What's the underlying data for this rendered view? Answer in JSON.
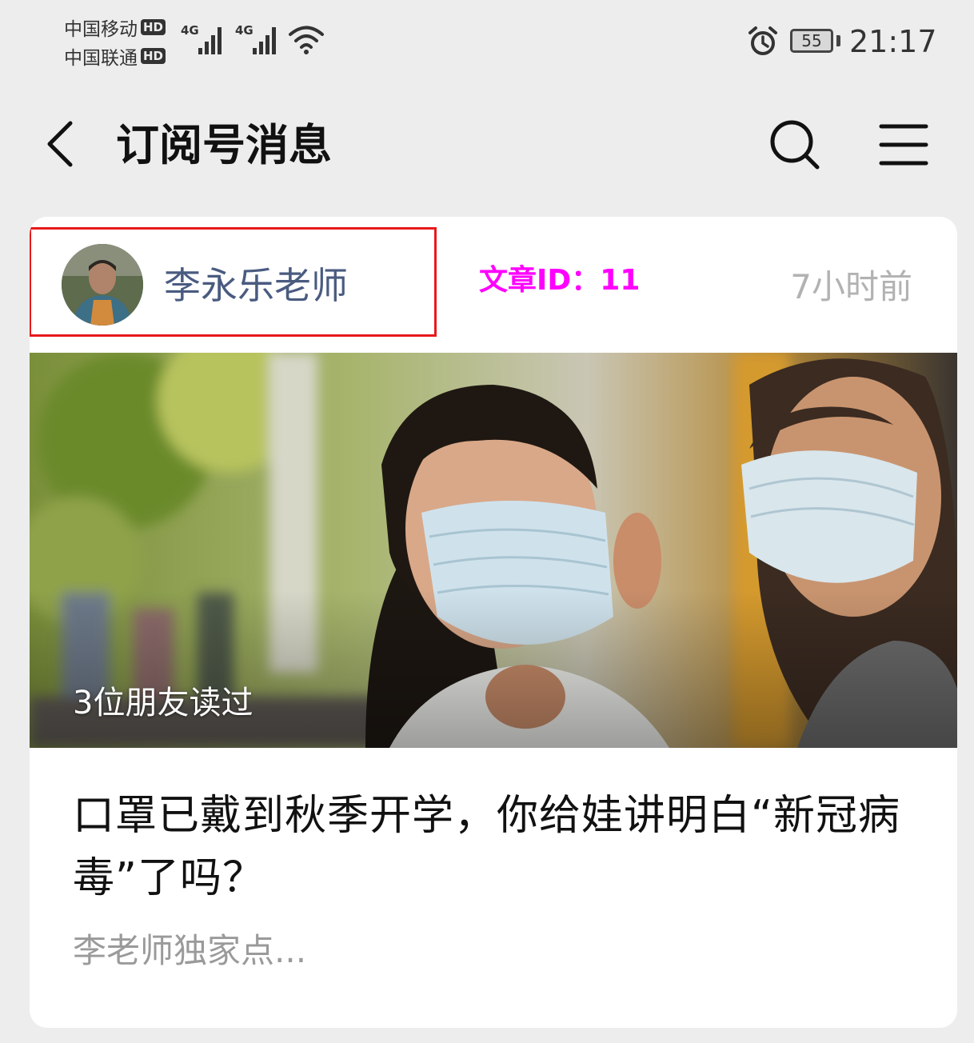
{
  "status_bar": {
    "carriers": [
      {
        "name": "中国移动",
        "badge": "HD"
      },
      {
        "name": "中国联通",
        "badge": "HD"
      }
    ],
    "network_label": "4G",
    "battery_level": "55",
    "time": "21:17"
  },
  "header": {
    "title": "订阅号消息"
  },
  "card": {
    "author_name": "李永乐老师",
    "article_id_label": "文章ID：11",
    "time_ago": "7小时前",
    "read_by": "3位朋友读过",
    "title": "口罩已戴到秋季开学，你给娃讲明白“新冠病毒”了吗？",
    "digest": "李老师独家点..."
  },
  "colors": {
    "background": "#ededed",
    "author_name": "#4a5b80",
    "highlight_border": "#e8191c",
    "article_id": "#ff00ff",
    "muted_text": "#9a9a9a"
  },
  "icons": [
    "alarm-icon",
    "wifi-icon",
    "signal-icon",
    "back-arrow-icon",
    "search-icon",
    "menu-icon"
  ]
}
